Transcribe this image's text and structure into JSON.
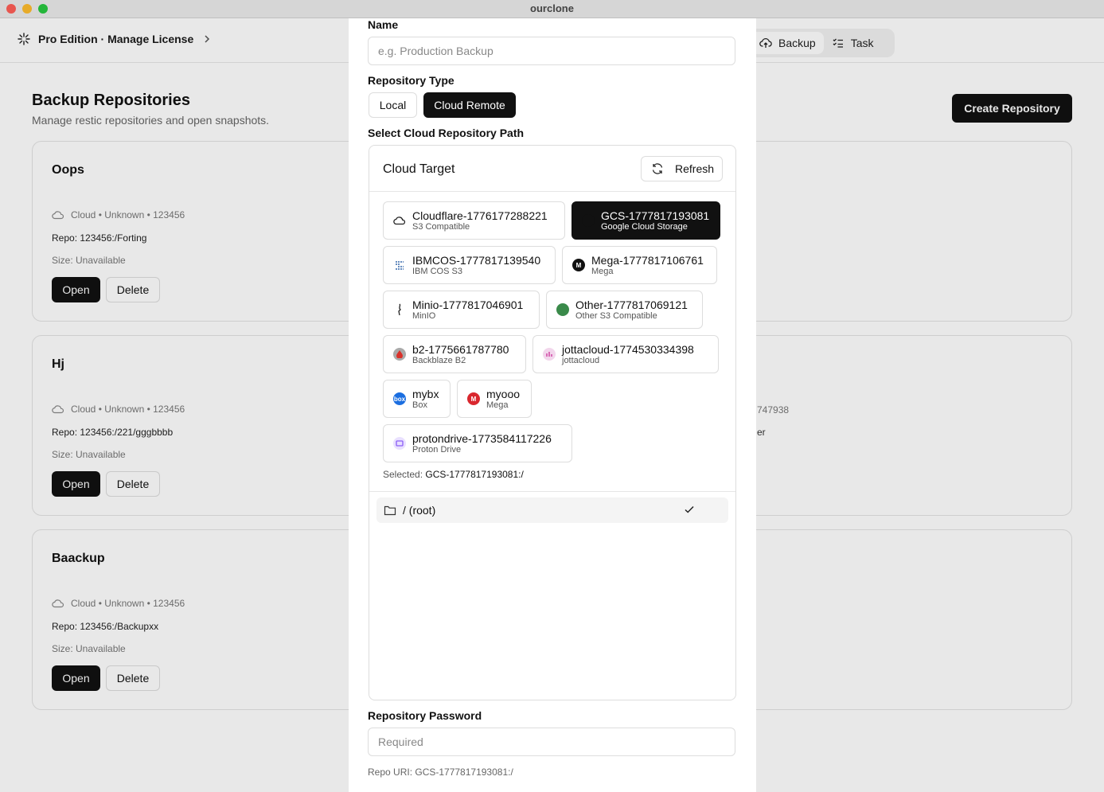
{
  "window": {
    "title": "ourclone"
  },
  "header": {
    "license_label": "Pro Edition · Manage License",
    "nav": [
      {
        "label": "Backup"
      },
      {
        "label": "Task"
      }
    ]
  },
  "page": {
    "title": "Backup Repositories",
    "subtitle": "Manage restic repositories and open snapshots.",
    "create_label": "Create Repository"
  },
  "repositories": [
    {
      "name": "Oops",
      "meta": "Cloud • Unknown • 123456",
      "repo": "Repo: 123456:/Forting",
      "size": "Size: Unavailable",
      "open_label": "Open",
      "delete_label": "Delete"
    },
    {
      "name": "Hj",
      "meta": "Cloud • Unknown • 123456",
      "repo": "Repo: 123456:/221/gggbbbb",
      "size": "Size: Unavailable",
      "open_label": "Open",
      "delete_label": "Delete",
      "right_meta": "747938",
      "right_repo": "er"
    },
    {
      "name": "Baackup",
      "meta": "Cloud • Unknown • 123456",
      "repo": "Repo: 123456:/Backupxx",
      "size": "Size: Unavailable",
      "open_label": "Open",
      "delete_label": "Delete"
    }
  ],
  "modal": {
    "name_label": "Name",
    "name_value": "",
    "name_placeholder": "e.g. Production Backup",
    "type_label": "Repository Type",
    "type_options": [
      "Local",
      "Cloud Remote"
    ],
    "type_selected": "Cloud Remote",
    "path_label": "Select Cloud Repository Path",
    "target_title": "Cloud Target",
    "refresh_label": "Refresh",
    "remotes": [
      {
        "name": "Cloudflare-1776177288221",
        "sub": "S3 Compatible",
        "icon": "cloud-icon",
        "color": "#ffffff",
        "selected": false
      },
      {
        "name": "GCS-1777817193081",
        "sub": "Google Cloud Storage",
        "icon": "gcs-icon",
        "color": "#111111",
        "selected": true
      },
      {
        "name": "IBMCOS-1777817139540",
        "sub": "IBM COS S3",
        "icon": "ibm-cos-icon",
        "color": "#ffffff",
        "selected": false
      },
      {
        "name": "Mega-1777817106761",
        "sub": "Mega",
        "icon": "mega-icon",
        "color": "#111111",
        "selected": false
      },
      {
        "name": "Minio-1777817046901",
        "sub": "MinIO",
        "icon": "minio-icon",
        "color": "#ffffff",
        "selected": false
      },
      {
        "name": "Other-1777817069121",
        "sub": "Other S3 Compatible",
        "icon": "globe-icon",
        "color": "#3a8a4a",
        "selected": false
      },
      {
        "name": "b2-1775661787780",
        "sub": "Backblaze B2",
        "icon": "backblaze-icon",
        "color": "#d9322b",
        "selected": false
      },
      {
        "name": "jottacloud-1774530334398",
        "sub": "jottacloud",
        "icon": "jottacloud-icon",
        "color": "#d34fa8",
        "selected": false
      },
      {
        "name": "mybx",
        "sub": "Box",
        "icon": "box-icon",
        "color": "#1b6ee0",
        "selected": false
      },
      {
        "name": "myooo",
        "sub": "Mega",
        "icon": "mega-icon",
        "color": "#d9272e",
        "selected": false
      },
      {
        "name": "protondrive-1773584117226",
        "sub": "Proton Drive",
        "icon": "proton-drive-icon",
        "color": "#8a5cf6",
        "selected": false
      }
    ],
    "selected_prefix": "Selected: ",
    "selected_value": "GCS-1777817193081:/",
    "folders": [
      {
        "label": "/ (root)",
        "checked": true
      }
    ],
    "password_label": "Repository Password",
    "password_value": "",
    "password_placeholder": "Required",
    "repo_uri": "Repo URI: GCS-1777817193081:/"
  },
  "colors": {
    "accent": "#111111",
    "traffic_close": "#ff5f57",
    "traffic_min": "#febc2e",
    "traffic_max": "#28c840"
  }
}
